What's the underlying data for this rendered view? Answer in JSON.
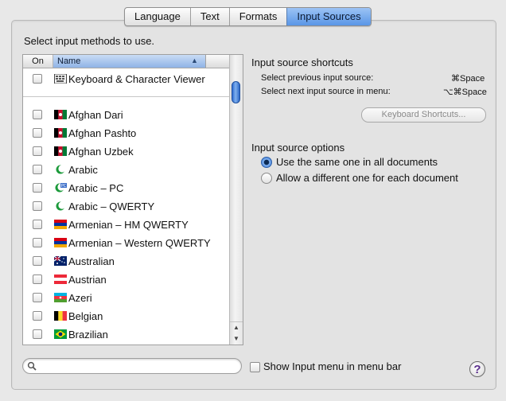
{
  "tabs": [
    {
      "label": "Language",
      "active": false
    },
    {
      "label": "Text",
      "active": false
    },
    {
      "label": "Formats",
      "active": false
    },
    {
      "label": "Input Sources",
      "active": true
    }
  ],
  "intro": "Select input methods to use.",
  "list": {
    "col_on": "On",
    "col_name": "Name",
    "top_item": {
      "label": "Keyboard & Character Viewer",
      "icon": "keyboard-viewer-icon"
    },
    "items": [
      {
        "label": "Afghan Dari",
        "icon": "afghanistan-flag-icon"
      },
      {
        "label": "Afghan Pashto",
        "icon": "afghanistan-flag-icon"
      },
      {
        "label": "Afghan Uzbek",
        "icon": "afghanistan-flag-icon"
      },
      {
        "label": "Arabic",
        "icon": "crescent-icon"
      },
      {
        "label": "Arabic – PC",
        "icon": "crescent-pc-icon"
      },
      {
        "label": "Arabic – QWERTY",
        "icon": "crescent-icon"
      },
      {
        "label": "Armenian – HM QWERTY",
        "icon": "armenia-flag-icon"
      },
      {
        "label": "Armenian – Western QWERTY",
        "icon": "armenia-flag-icon"
      },
      {
        "label": "Australian",
        "icon": "australia-flag-icon"
      },
      {
        "label": "Austrian",
        "icon": "austria-flag-icon"
      },
      {
        "label": "Azeri",
        "icon": "azerbaijan-flag-icon"
      },
      {
        "label": "Belgian",
        "icon": "belgium-flag-icon"
      },
      {
        "label": "Brazilian",
        "icon": "brazil-flag-icon"
      }
    ]
  },
  "shortcuts": {
    "title": "Input source shortcuts",
    "prev_label": "Select previous input source:",
    "prev_key": "⌘Space",
    "next_label": "Select next input source in menu:",
    "next_key": "⌥⌘Space",
    "button": "Keyboard Shortcuts..."
  },
  "options": {
    "title": "Input source options",
    "same": "Use the same one in all documents",
    "different": "Allow a different one for each document",
    "selected": "same"
  },
  "search": {
    "placeholder": ""
  },
  "show_menu": "Show Input menu in menu bar",
  "help": "?"
}
